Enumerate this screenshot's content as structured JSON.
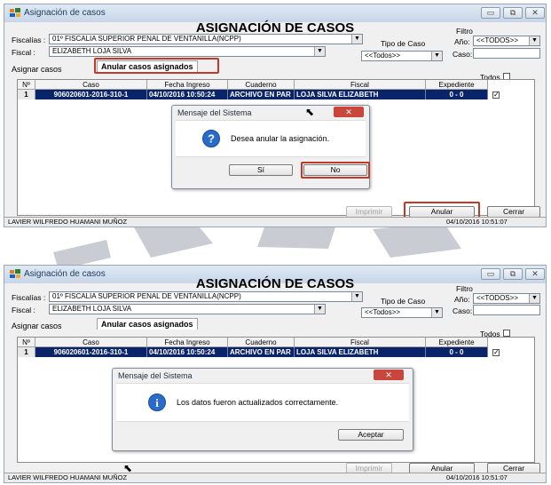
{
  "window": {
    "title": "Asignación de casos",
    "heading": "ASIGNACIÓN DE CASOS",
    "minimize_glyph": "▭",
    "maximize_glyph": "⧉",
    "close_glyph": "✕"
  },
  "filters": {
    "fiscalias_label": "Fiscalías :",
    "fiscalias_value": "01º FISCALIA SUPERIOR PENAL DE VENTANILLA(NCPP)",
    "fiscal_label": "Fiscal :",
    "fiscal_value": "ELIZABETH LOJA SILVA",
    "tipo_caso_label": "Tipo de Caso",
    "tipo_caso_value": "<<Todos>>",
    "filtro_label": "Filtro",
    "anio_label": "Año:",
    "anio_value": "<<TODOS>>",
    "caso_label": "Caso:"
  },
  "tabs": [
    {
      "label": "Asignar casos"
    },
    {
      "label": "Anular casos asignados"
    }
  ],
  "todos_label": "Todos",
  "table": {
    "headers": [
      "Nº",
      "Caso",
      "Fecha Ingreso",
      "Cuaderno",
      "Fiscal",
      "Expediente"
    ],
    "rows": [
      {
        "num": "1",
        "caso": "906020601-2016-310-1",
        "fecha": "04/10/2016 10:50:24",
        "cuaderno": "ARCHIVO EN PAR",
        "fiscal": "LOJA SILVA ELIZABETH",
        "expediente": "0 - 0"
      }
    ],
    "row_checked": "✓"
  },
  "buttons": {
    "imprimir": "Imprimir",
    "anular": "Anular",
    "cerrar": "Cerrar"
  },
  "status": {
    "user": "LAVIER WILFREDO HUAMANI MUÑOZ",
    "datetime": "04/10/2016 10:51:07"
  },
  "dialog1": {
    "title": "Mensaje del Sistema",
    "message": "Desea anular la asignación.",
    "yes": "Sí",
    "no": "No",
    "icon": "question-icon"
  },
  "dialog2": {
    "title": "Mensaje del Sistema",
    "message": "Los datos fueron actualizados correctamente.",
    "ok": "Aceptar",
    "icon": "info-icon"
  },
  "colors": {
    "highlight": "#c0392b",
    "selected_row": "#0a246a",
    "diagonal_stroke": "#c5c9cf"
  }
}
